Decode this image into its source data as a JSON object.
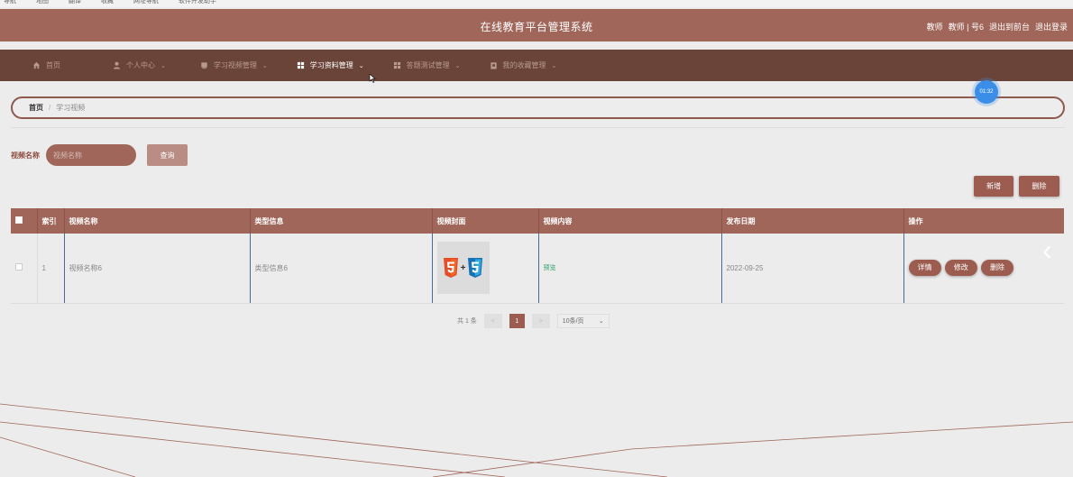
{
  "bookmarks": [
    "导航",
    "地图",
    "翻译",
    "收藏",
    "网址导航",
    "软件开发助手"
  ],
  "header": {
    "title": "在线教育平台管理系统",
    "user_role": "教师",
    "user_name": "教师 | 号6",
    "back_to_frontend": "退出到前台",
    "logout": "退出登录"
  },
  "nav": {
    "items": [
      {
        "label": "首页",
        "icon": "home-icon"
      },
      {
        "label": "个人中心",
        "icon": "user-icon",
        "chevron": "⌄"
      },
      {
        "label": "学习视频管理",
        "icon": "video-icon",
        "chevron": "⌄"
      },
      {
        "label": "学习资料管理",
        "icon": "grid-icon",
        "chevron": "⌄"
      },
      {
        "label": "答题测试管理",
        "icon": "grid-icon",
        "chevron": "⌄"
      },
      {
        "label": "我的收藏管理",
        "icon": "clipboard-icon",
        "chevron": "⌄"
      }
    ],
    "active_index": 3
  },
  "breadcrumb": {
    "home": "首页",
    "separator": "/",
    "current": "学习视频"
  },
  "timer": "01:32",
  "search": {
    "label": "视频名称",
    "placeholder": "视频名称",
    "button": "查询"
  },
  "actions": {
    "add": "新增",
    "delete": "删除"
  },
  "table": {
    "columns": [
      "",
      "索引",
      "视频名称",
      "类型信息",
      "视频封面",
      "视频内容",
      "发布日期",
      "操作"
    ],
    "rows": [
      {
        "index": "1",
        "name": "视频名称6",
        "type": "类型信息6",
        "cover": "html5-css3-logo",
        "content": "预览",
        "date": "2022-09-25",
        "ops": [
          "详情",
          "修改",
          "删除"
        ]
      }
    ]
  },
  "pager": {
    "total": "共 1 条",
    "prev": "<",
    "current": "1",
    "next": ">",
    "page_size": "10条/页"
  },
  "colors": {
    "primary": "#a0665a",
    "nav_bg": "#6b4439",
    "button": "#9c5d50"
  }
}
